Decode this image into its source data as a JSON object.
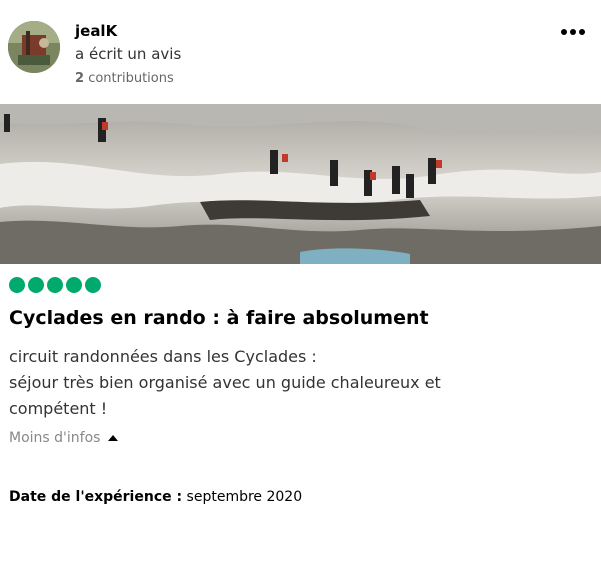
{
  "review": {
    "author": {
      "username": "jealK",
      "action": "a écrit un avis",
      "contributions_count": "2",
      "contributions_label": "contributions"
    },
    "more_icon": "more-dots-icon",
    "photo_icon": "hikers-rocky-coast-photo",
    "rating": {
      "value": 5,
      "max": 5,
      "color": "#00aa6c"
    },
    "title": "Cyclades en rando : à faire absolument",
    "body_lines": [
      "circuit randonnées dans les Cyclades :",
      "séjour très bien organisé avec un guide chaleureux et",
      "compétent !"
    ],
    "toggle_label": "Moins d'infos",
    "date_label": "Date de l'expérience :",
    "date_value": "septembre 2020"
  }
}
